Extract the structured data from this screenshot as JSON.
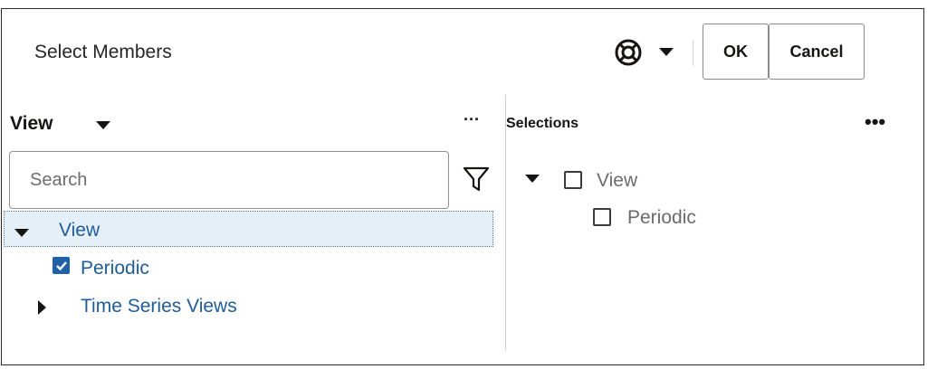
{
  "dialog": {
    "title": "Select Members",
    "ok_label": "OK",
    "cancel_label": "Cancel"
  },
  "left_panel": {
    "dimension_label": "View",
    "more_label": "···",
    "search": {
      "placeholder": "Search",
      "value": ""
    },
    "tree": [
      {
        "label": "View",
        "expanded": true,
        "selected_row": true
      },
      {
        "label": "Periodic",
        "checked": true
      },
      {
        "label": "Time Series Views",
        "expanded": false
      }
    ]
  },
  "right_panel": {
    "title": "Selections",
    "more_label": "•••",
    "tree": [
      {
        "label": "View",
        "expanded": true,
        "checked": false
      },
      {
        "label": "Periodic",
        "checked": false
      }
    ]
  },
  "icons": {
    "help": "lifebuoy-icon",
    "filter": "funnel-icon"
  },
  "colors": {
    "link_blue": "#1f5c99",
    "selected_row_bg": "#e4eff8",
    "checkbox_blue": "#2161a8"
  }
}
